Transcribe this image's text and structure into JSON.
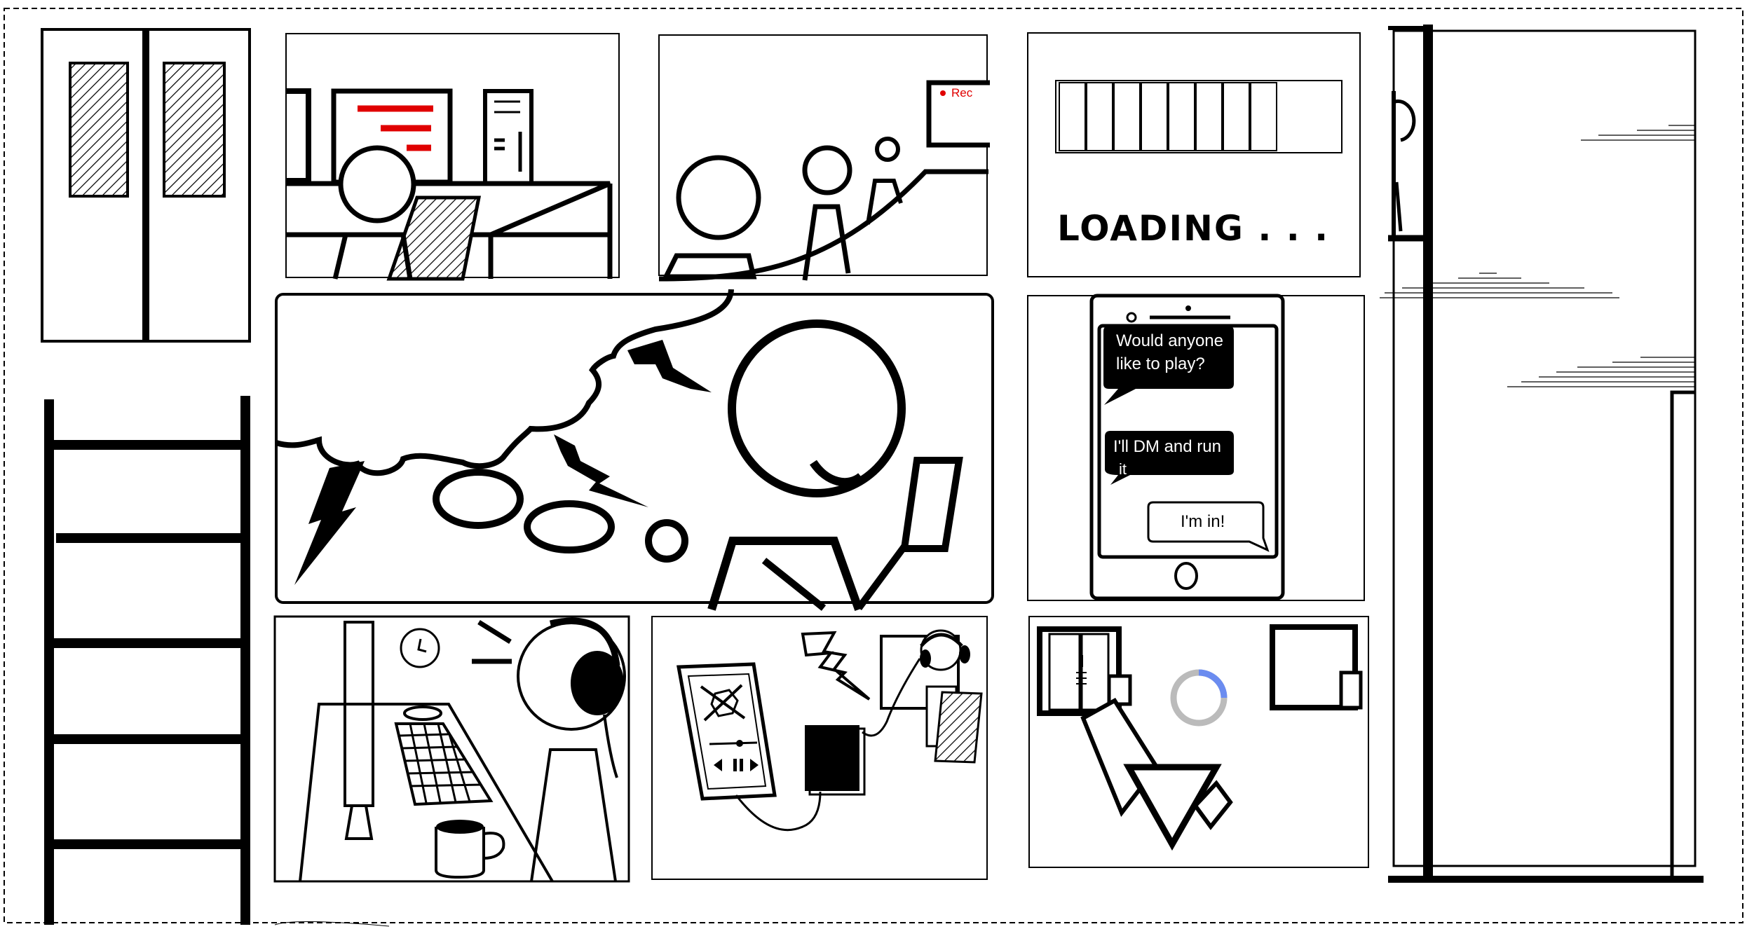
{
  "scene": {
    "record_indicator": {
      "label": "Rec",
      "color": "#e00000"
    },
    "loading_panel": {
      "label": "LOADING . . .",
      "progress_segments": 8
    },
    "chat": {
      "messages": [
        {
          "line1": "Would anyone",
          "line2": "like to play?",
          "style": "incoming"
        },
        {
          "line1": "I'll DM and run",
          "line2": "it",
          "style": "incoming"
        },
        {
          "line1": "I'm in!",
          "line2": "",
          "style": "outgoing"
        }
      ]
    },
    "spinner": {
      "accent": "#6b8cf0",
      "track": "#bbbbbb"
    },
    "accent_red": "#e00000",
    "icons": [
      "door-icon",
      "ladder-icon",
      "monitor-icon",
      "person-icon",
      "camera-icon",
      "phone-icon",
      "headphones-icon",
      "dice-icon",
      "cursor-icon",
      "clock-icon",
      "mug-icon",
      "keyboard-icon",
      "lightning-icon",
      "speech-bubble-icon"
    ]
  }
}
